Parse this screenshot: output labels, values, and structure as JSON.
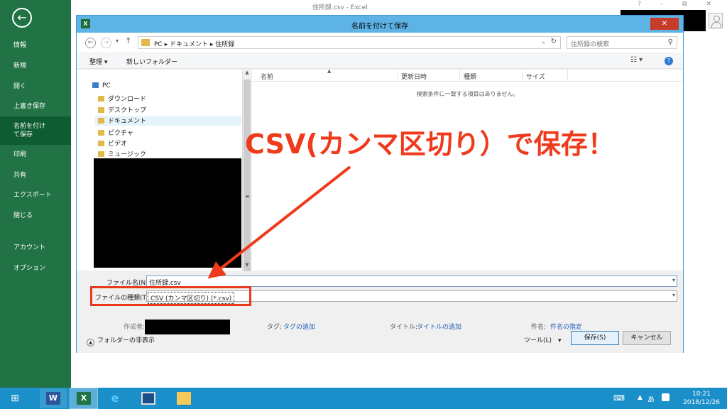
{
  "window": {
    "title": "住所録.csv - Excel",
    "controls": "? – ⧉ ✕"
  },
  "backstage": {
    "items": [
      "情報",
      "新規",
      "開く",
      "上書き保存",
      "名前を付けて保存",
      "印刷",
      "共有",
      "エクスポート",
      "閉じる",
      "アカウント",
      "オプション"
    ],
    "active_index": 4
  },
  "dialog": {
    "title": "名前を付けて保存",
    "close": "✕",
    "address": {
      "path": "PC ▸ ドキュメント ▸ 住所録",
      "drop": "⌄",
      "refresh": "↻"
    },
    "search_placeholder": "住所録の検索",
    "toolbar": {
      "organize": "整理 ▾",
      "new_folder": "新しいフォルダー",
      "view": "☷ ▾",
      "help": "?"
    },
    "tree": [
      {
        "label": "PC"
      },
      {
        "label": "ダウンロード"
      },
      {
        "label": "デスクトップ"
      },
      {
        "label": "ドキュメント"
      },
      {
        "label": "ピクチャ"
      },
      {
        "label": "ビデオ"
      },
      {
        "label": "ミュージック"
      }
    ],
    "columns": [
      "名前",
      "更新日時",
      "種類",
      "サイズ"
    ],
    "empty_message": "検索条件に一致する項目はありません。",
    "filename_label": "ファイル名(N):",
    "filename_value": "住所録.csv",
    "filetype_label": "ファイルの種類(T):",
    "filetype_value": "CSV (カンマ区切り) (*.csv)",
    "author_label": "作成者:",
    "tags_label": "タグ:",
    "tags_value": "タグの追加",
    "title_label": "タイトル:",
    "title_value": "タイトルの追加",
    "subject_label": "件名:",
    "subject_value": "件名の指定",
    "hide_folders": "フォルダーの非表示",
    "tools": "ツール(L)　▾",
    "save": "保存(S)",
    "cancel": "キャンセル"
  },
  "annotation": "CSV(カンマ区切り）で保存！",
  "taskbar": {
    "time": "10:21",
    "date": "2018/12/26",
    "ime": "あ"
  },
  "colors": {
    "excel_green": "#217346",
    "annotation_red": "#ef3a1c",
    "dialog_title": "#5db2e6",
    "taskbar": "#1b8fc9"
  }
}
